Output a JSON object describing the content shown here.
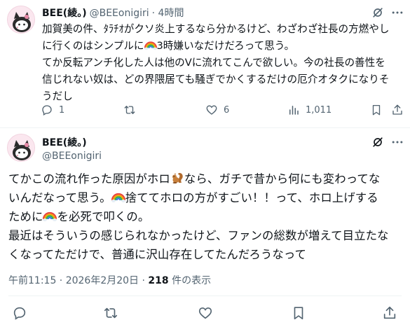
{
  "tweet1": {
    "display_name": "BEE(綾。)",
    "handle": "@BEEonigiri",
    "time": "· 4時間",
    "lines": [
      {
        "pre": "加賀美の件、ﾀﾗﾁｵがクソ炎上するなら分かるけど、わざわざ社長の方燃やし",
        "emoji": false,
        "post": ""
      },
      {
        "pre": "に行くのはシンプルに",
        "emoji": true,
        "post": "3時嫌いなだけだろって思う。"
      },
      {
        "pre": "てか反転アンチ化した人は他のVに流れてこんで欲しい。今の社長の善性を",
        "emoji": false,
        "post": ""
      },
      {
        "pre": "信じれない奴は、どの界隈居ても騒ぎでかくするだけの厄介オタクになりそ",
        "emoji": false,
        "post": ""
      },
      {
        "pre": "うだし",
        "emoji": false,
        "post": ""
      }
    ],
    "reply_count": "1",
    "retweet_count": "",
    "like_count": "6",
    "view_count": "1,011"
  },
  "tweet2": {
    "display_name": "BEE(綾。)",
    "handle": "@BEEonigiri",
    "lines": [
      {
        "a": "てかこの流れ作った原因がホロ",
        "e": "squirrel",
        "b": "なら、ガチで昔から何にも変わってな"
      },
      {
        "a": "いんだなって思う。",
        "e": "rainbow",
        "b": "捨ててホロの方がすごい！！って、ホロ上げする"
      },
      {
        "a": "ために",
        "e": "rainbow",
        "b": "を必死で叩くの。"
      },
      {
        "a": "最近はそういうの感じられなかったけど、ファンの総数が増えて目立たな",
        "e": "",
        "b": ""
      },
      {
        "a": "くなってただけで、普通に沢山存在してたんだろうなって",
        "e": "",
        "b": ""
      }
    ],
    "timestamp": "午前11:15 · 2026年2月20日 · ",
    "views_number": "218",
    "views_label": " 件の表示"
  },
  "icons": {
    "grok": "grok-icon",
    "more": "more-icon",
    "reply": "reply-icon",
    "retweet": "retweet-icon",
    "like": "like-icon",
    "views": "views-icon",
    "bookmark": "bookmark-icon",
    "share": "share-icon"
  },
  "colors": {
    "text": "#0f1419",
    "secondary": "#536471",
    "border": "#eff3f4"
  }
}
